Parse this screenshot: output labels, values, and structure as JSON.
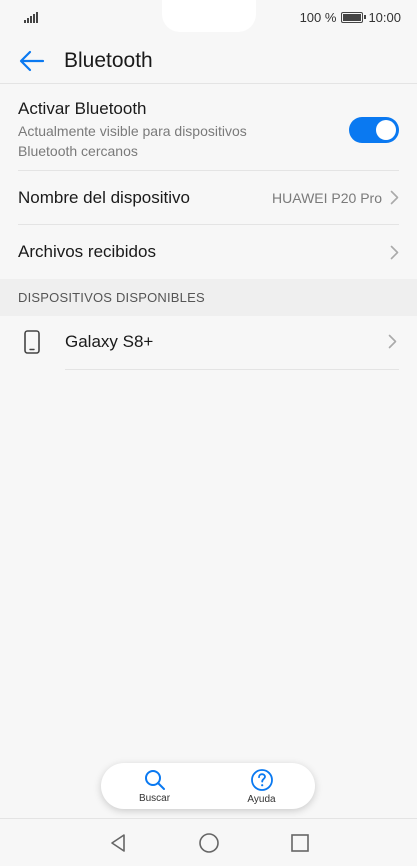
{
  "status_bar": {
    "battery_pct": "100 %",
    "time": "10:00"
  },
  "header": {
    "title": "Bluetooth"
  },
  "bluetooth_toggle": {
    "title": "Activar Bluetooth",
    "subtitle_line1": "Actualmente visible para dispositivos",
    "subtitle_line2": "Bluetooth cercanos",
    "enabled": true
  },
  "device_name": {
    "label": "Nombre del dispositivo",
    "value": "HUAWEI P20 Pro"
  },
  "received_files": {
    "label": "Archivos recibidos"
  },
  "available_section": {
    "title": "DISPOSITIVOS DISPONIBLES"
  },
  "devices": [
    {
      "name": "Galaxy S8+"
    }
  ],
  "bottom_menu": {
    "search_label": "Buscar",
    "help_label": "Ayuda"
  },
  "colors": {
    "accent": "#0a79f1",
    "background": "#f7f7f7",
    "section": "#efefef"
  }
}
